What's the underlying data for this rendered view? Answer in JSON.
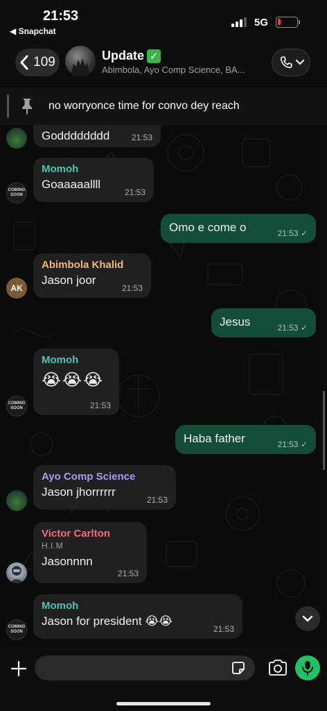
{
  "status_bar": {
    "time": "21:53",
    "back_app": "◀ Snapchat",
    "network": "5G"
  },
  "header": {
    "back_count": "109",
    "title": "Update",
    "title_badge": "✓",
    "subtitle": "Abimbola, Ayo Comp Science, BA..."
  },
  "pinned": {
    "text": "no worryonce time for convo dey reach"
  },
  "messages": [
    {
      "text": "Godddddddd",
      "time": "21:53"
    },
    {
      "sender": "Momoh",
      "sender_color": "#4fc3b4",
      "text": "Goaaaaallll",
      "time": "21:53"
    },
    {
      "text": "Omo e come o",
      "time": "21:53 ✓"
    },
    {
      "sender": "Abimbola Khalid",
      "sender_color": "#f0b87a",
      "avatar_initials": "AK",
      "text": "Jason joor",
      "time": "21:53"
    },
    {
      "text": "Jesus",
      "time": "21:53 ✓"
    },
    {
      "sender": "Momoh",
      "sender_color": "#4fc3b4",
      "text": "😭😭😭",
      "time": "21:53"
    },
    {
      "text": "Haba father",
      "time": "21:53 ✓"
    },
    {
      "sender": "Ayo Comp Science",
      "sender_color": "#a79cf5",
      "text": "Jason jhorrrrrr",
      "time": "21:53"
    },
    {
      "sender": "Victor Carlton",
      "sender_color": "#f46a7a",
      "sender_sub": "H.I.M",
      "text": "Jasonnnn",
      "time": "21:53"
    },
    {
      "sender": "Momoh",
      "sender_color": "#4fc3b4",
      "text": "Jason for president 😭😭",
      "time": "21:53"
    }
  ],
  "avatar_labels": {
    "coming_soon": "COMING SOON"
  },
  "input": {
    "placeholder": ""
  },
  "colors": {
    "incoming_bubble": "#202020",
    "outgoing_bubble": "#144d37",
    "accent_green": "#21c063",
    "background": "#0b0b0b"
  }
}
